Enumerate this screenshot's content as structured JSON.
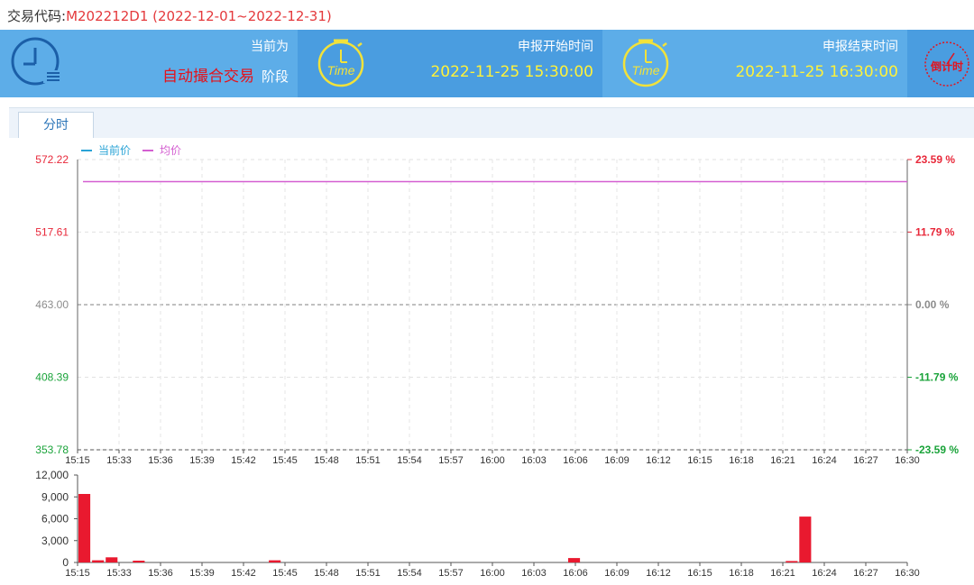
{
  "header": {
    "label": "交易代码:",
    "code": "M202212D1 (2022-12-01~2022-12-31)"
  },
  "phase_panel": {
    "label": "当前为",
    "value": "自动撮合交易",
    "suffix": "阶段"
  },
  "start_panel": {
    "label": "申报开始时间",
    "value": "2022-11-25 15:30:00",
    "icon": "clock-time-icon",
    "icon_text": "Time"
  },
  "end_panel": {
    "label": "申报结束时间",
    "value": "2022-11-25 16:30:00",
    "icon": "clock-time-icon",
    "icon_text": "Time"
  },
  "countdown": {
    "label": "倒计时",
    "icon": "stopwatch-icon"
  },
  "tabs": [
    {
      "label": "分时"
    }
  ],
  "colors": {
    "banner": "#5dade8",
    "panel_dark": "#4a9de0",
    "price_line": "#29a3d6",
    "avg_line": "#d45fd1",
    "up": "#e8283a",
    "down": "#1aa33a",
    "flat": "#8c8c8c",
    "volume_bar": "#e9192f"
  },
  "chart_data": {
    "type": "line",
    "legend": [
      {
        "name": "当前价",
        "color": "#29a3d6"
      },
      {
        "name": "均价",
        "color": "#d45fd1"
      }
    ],
    "legend_position": "top-left",
    "grid": true,
    "price_axis": {
      "ticks": [
        "572.22",
        "517.61",
        "463.00",
        "408.39",
        "353.78"
      ],
      "values": [
        572.22,
        517.61,
        463.0,
        408.39,
        353.78
      ],
      "ylim": [
        353.78,
        572.22
      ],
      "base": 463.0
    },
    "percent_axis": {
      "ticks": [
        "23.59 %",
        "11.79 %",
        "0.00 %",
        "-11.79 %",
        "-23.59 %"
      ]
    },
    "x_ticks": [
      "15:15",
      "15:33",
      "15:36",
      "15:39",
      "15:42",
      "15:45",
      "15:48",
      "15:51",
      "15:54",
      "15:57",
      "16:00",
      "16:03",
      "16:06",
      "16:09",
      "16:12",
      "16:15",
      "16:18",
      "16:21",
      "16:24",
      "16:27",
      "16:30"
    ],
    "series": [
      {
        "name": "均价",
        "x": [
          "15:15",
          "16:30"
        ],
        "values": [
          555.6,
          555.6
        ]
      }
    ],
    "volume": {
      "ticks": [
        "12,000",
        "9,000",
        "6,000",
        "3,000",
        "0"
      ],
      "ylim": [
        0,
        12000
      ],
      "bars": [
        {
          "x": "15:15",
          "slot": 0,
          "value": 9400
        },
        {
          "x": "15:15",
          "slot": 1,
          "value": 300
        },
        {
          "x": "15:15",
          "slot": 2,
          "value": 700
        },
        {
          "x": "15:33",
          "slot": 4,
          "value": 250
        },
        {
          "x": "15:45",
          "slot": 14,
          "value": 300
        },
        {
          "x": "16:06",
          "slot": 36,
          "value": 600
        },
        {
          "x": "16:21",
          "slot": 52,
          "value": 200
        },
        {
          "x": "16:24",
          "slot": 53,
          "value": 6300
        }
      ]
    }
  }
}
